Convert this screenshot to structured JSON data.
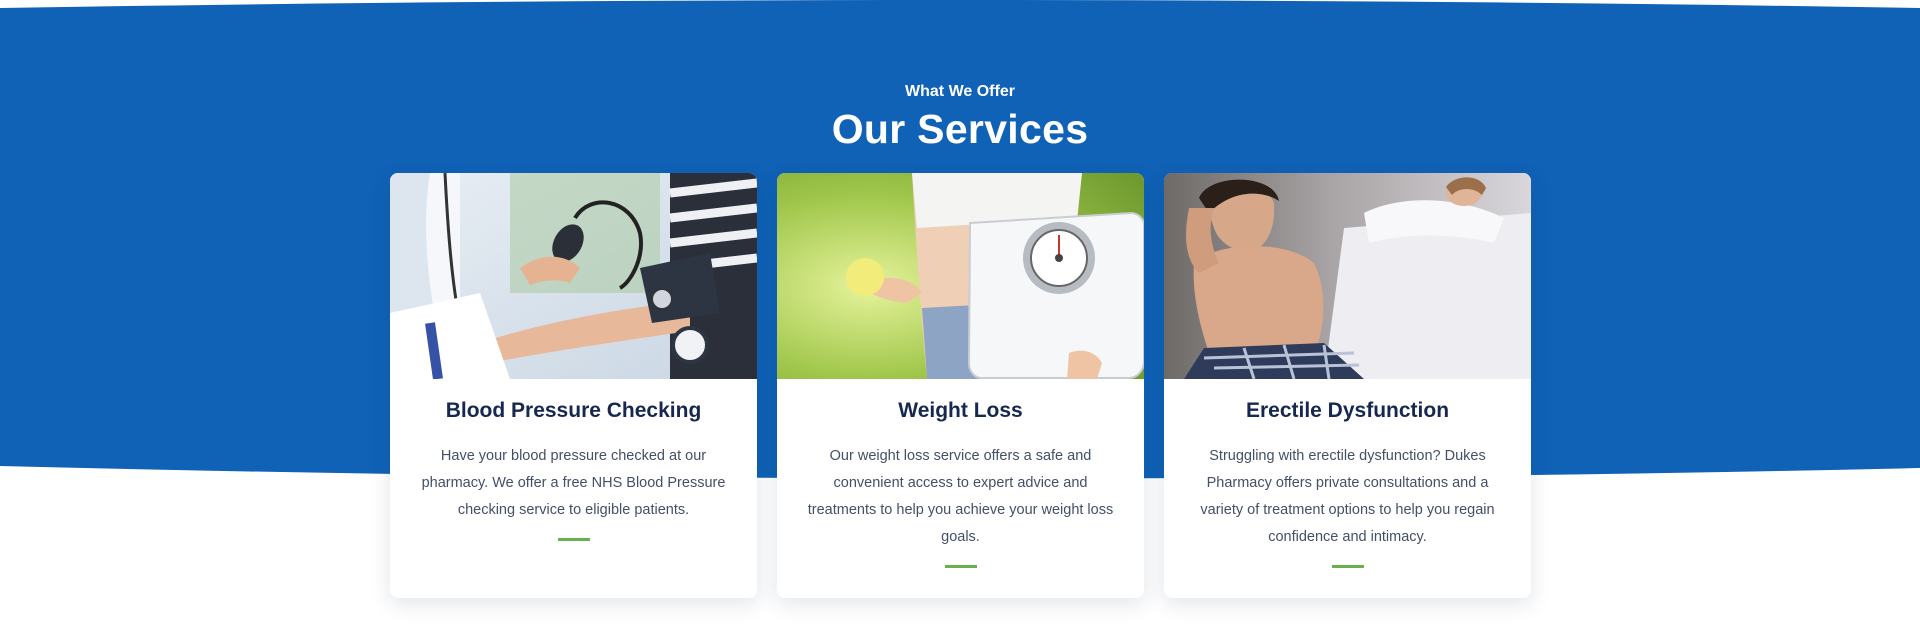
{
  "section": {
    "eyebrow": "What We Offer",
    "title": "Our Services",
    "background_color": "#1062b6",
    "accent_color": "#6ab04c"
  },
  "services": [
    {
      "title": "Blood Pressure Checking",
      "description": "Have your blood pressure checked at our pharmacy. We offer a free NHS Blood Pressure checking service to eligible patients."
    },
    {
      "title": "Weight Loss",
      "description": "Our weight loss service offers a safe and convenient access to expert advice and treatments to help you achieve your weight loss goals."
    },
    {
      "title": "Erectile Dysfunction",
      "description": "Struggling with erectile dysfunction? Dukes Pharmacy offers private consultations and a variety of treatment options to help you regain confidence and intimacy."
    }
  ]
}
